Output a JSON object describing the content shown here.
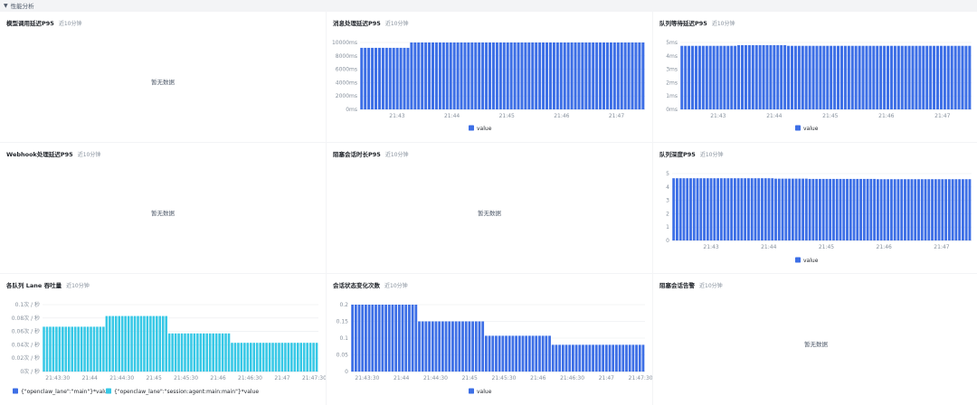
{
  "section": {
    "title": "性能分析"
  },
  "colors": {
    "blue": "#3d6fe6",
    "cyan": "#37c8e6",
    "grid": "#e8eaed",
    "axis": "#86909c"
  },
  "panels": [
    {
      "id": "model-call-latency",
      "title": "模型调用延迟P95",
      "subtitle": "近10分钟",
      "empty": "暂无数据"
    },
    {
      "id": "msg-latency",
      "title": "消息处理延迟P95",
      "subtitle": "近10分钟",
      "legend": [
        "value"
      ]
    },
    {
      "id": "queue-wait",
      "title": "队列等待延迟P95",
      "subtitle": "近10分钟",
      "legend": [
        "value"
      ]
    },
    {
      "id": "webhook-latency",
      "title": "Webhook处理延迟P95",
      "subtitle": "近10分钟",
      "empty": "暂无数据"
    },
    {
      "id": "blocked-session",
      "title": "阻塞会话时长P95",
      "subtitle": "近10分钟",
      "empty": "暂无数据"
    },
    {
      "id": "queue-depth",
      "title": "队列深度P95",
      "subtitle": "近10分钟",
      "legend": [
        "value"
      ]
    },
    {
      "id": "lane-throughput",
      "title": "各队列 Lane 吞吐量",
      "subtitle": "近10分钟",
      "legend": [
        "{\"openclaw_lane\":\"main\"}*value",
        "{\"openclaw_lane\":\"session:agent:main:main\"}*value"
      ]
    },
    {
      "id": "session-state",
      "title": "会话状态变化次数",
      "subtitle": "近10分钟",
      "legend": [
        "value"
      ]
    },
    {
      "id": "blocked-alert",
      "title": "阻塞会话告警",
      "subtitle": "近10分钟",
      "empty": "暂无数据"
    }
  ],
  "chart_data": [
    {
      "type": "bar",
      "panel": "msg-latency",
      "y_ticks": [
        "0ms",
        "2000ms",
        "4000ms",
        "6000ms",
        "8000ms",
        "10000ms"
      ],
      "x_ticks": [
        "21:43",
        "21:44",
        "21:45",
        "21:46",
        "21:47"
      ],
      "ylim": [
        0,
        10000
      ],
      "series": [
        {
          "name": "value",
          "values": [
            9200,
            9200,
            9200,
            9200,
            9200,
            9200,
            9200,
            9200,
            9200,
            9200,
            9200,
            9200,
            9200,
            9200,
            10000,
            10000,
            10000,
            10000,
            10000,
            10000,
            10000,
            10000,
            10000,
            10000,
            10000,
            10000,
            10000,
            10000,
            10000,
            10000,
            10000,
            10000,
            10000,
            10000,
            10000,
            10000,
            10000,
            10000,
            10000,
            10000,
            10000,
            10000,
            10000,
            10000,
            10000,
            10000,
            10000,
            10000,
            10000,
            10000,
            10000,
            10000,
            10000,
            10000,
            10000,
            10000,
            10000,
            10000,
            10000,
            10000,
            10000,
            10000,
            10000,
            10000,
            10000,
            10000,
            10000,
            10000,
            10000,
            10000,
            10000,
            10000,
            10000,
            10000,
            10000,
            10000,
            10000,
            10000,
            10000,
            10000
          ]
        }
      ]
    },
    {
      "type": "bar",
      "panel": "queue-wait",
      "y_ticks": [
        "0ms",
        "1ms",
        "2ms",
        "3ms",
        "4ms",
        "5ms"
      ],
      "x_ticks": [
        "21:43",
        "21:44",
        "21:45",
        "21:46",
        "21:47"
      ],
      "ylim": [
        0,
        5
      ],
      "series": [
        {
          "name": "value",
          "values": [
            4.75,
            4.75,
            4.75,
            4.75,
            4.75,
            4.75,
            4.75,
            4.75,
            4.75,
            4.75,
            4.75,
            4.75,
            4.75,
            4.75,
            4.75,
            4.75,
            4.8,
            4.8,
            4.8,
            4.8,
            4.8,
            4.8,
            4.8,
            4.8,
            4.8,
            4.8,
            4.8,
            4.8,
            4.8,
            4.8,
            4.75,
            4.75,
            4.75,
            4.75,
            4.75,
            4.75,
            4.75,
            4.75,
            4.75,
            4.75,
            4.75,
            4.75,
            4.75,
            4.75,
            4.75,
            4.75,
            4.75,
            4.75,
            4.75,
            4.75,
            4.75,
            4.75,
            4.75,
            4.75,
            4.75,
            4.75,
            4.75,
            4.75,
            4.75,
            4.75,
            4.75,
            4.75,
            4.75,
            4.75,
            4.75,
            4.75,
            4.75,
            4.75,
            4.75,
            4.75,
            4.75,
            4.75,
            4.75,
            4.75,
            4.75,
            4.75,
            4.75,
            4.75,
            4.75,
            4.75,
            4.75,
            4.75
          ]
        }
      ]
    },
    {
      "type": "bar",
      "panel": "queue-depth",
      "y_ticks": [
        "0",
        "1",
        "2",
        "3",
        "4",
        "5"
      ],
      "x_ticks": [
        "21:43",
        "21:44",
        "21:45",
        "21:46",
        "21:47"
      ],
      "ylim": [
        0,
        5
      ],
      "series": [
        {
          "name": "value",
          "values": [
            4.65,
            4.65,
            4.65,
            4.65,
            4.65,
            4.65,
            4.65,
            4.65,
            4.65,
            4.65,
            4.65,
            4.65,
            4.65,
            4.65,
            4.65,
            4.65,
            4.65,
            4.65,
            4.65,
            4.65,
            4.65,
            4.65,
            4.65,
            4.65,
            4.65,
            4.65,
            4.65,
            4.65,
            4.65,
            4.65,
            4.62,
            4.62,
            4.62,
            4.62,
            4.62,
            4.62,
            4.62,
            4.62,
            4.62,
            4.62,
            4.6,
            4.6,
            4.6,
            4.6,
            4.6,
            4.6,
            4.6,
            4.6,
            4.6,
            4.6,
            4.6,
            4.6,
            4.6,
            4.6,
            4.6,
            4.6,
            4.6,
            4.6,
            4.6,
            4.6,
            4.58,
            4.58,
            4.58,
            4.58,
            4.58,
            4.58,
            4.58,
            4.58,
            4.58,
            4.58,
            4.58,
            4.58,
            4.58,
            4.58,
            4.58,
            4.58,
            4.58,
            4.58,
            4.58,
            4.58,
            4.58,
            4.58,
            4.58,
            4.58,
            4.58,
            4.58,
            4.58,
            4.58
          ]
        }
      ]
    },
    {
      "type": "bar",
      "panel": "lane-throughput",
      "y_ticks": [
        "0次 / 秒",
        "0.02次 / 秒",
        "0.04次 / 秒",
        "0.06次 / 秒",
        "0.08次 / 秒",
        "0.1次 / 秒"
      ],
      "x_ticks": [
        "21:43:30",
        "21:44",
        "21:44:30",
        "21:45",
        "21:45:30",
        "21:46",
        "21:46:30",
        "21:47",
        "21:47:30"
      ],
      "ylim": [
        0,
        0.1
      ],
      "series": [
        {
          "name": "{\"openclaw_lane\":\"main\"}*value",
          "values": []
        },
        {
          "name": "{\"openclaw_lane\":\"session:agent:main:main\"}*value",
          "values": [
            0.067,
            0.067,
            0.067,
            0.067,
            0.067,
            0.067,
            0.067,
            0.067,
            0.067,
            0.067,
            0.067,
            0.067,
            0.067,
            0.067,
            0.067,
            0.067,
            0.067,
            0.067,
            0.067,
            0.067,
            0.083,
            0.083,
            0.083,
            0.083,
            0.083,
            0.083,
            0.083,
            0.083,
            0.083,
            0.083,
            0.083,
            0.083,
            0.083,
            0.083,
            0.083,
            0.083,
            0.083,
            0.083,
            0.083,
            0.083,
            0.057,
            0.057,
            0.057,
            0.057,
            0.057,
            0.057,
            0.057,
            0.057,
            0.057,
            0.057,
            0.057,
            0.057,
            0.057,
            0.057,
            0.057,
            0.057,
            0.057,
            0.057,
            0.057,
            0.057,
            0.043,
            0.043,
            0.043,
            0.043,
            0.043,
            0.043,
            0.043,
            0.043,
            0.043,
            0.043,
            0.043,
            0.043,
            0.043,
            0.043,
            0.043,
            0.043,
            0.043,
            0.043,
            0.043,
            0.043,
            0.043,
            0.043,
            0.043,
            0.043,
            0.043,
            0.043,
            0.043,
            0.043
          ]
        }
      ]
    },
    {
      "type": "bar",
      "panel": "session-state",
      "y_ticks": [
        "0",
        "0.05",
        "0.1",
        "0.15",
        "0.2"
      ],
      "x_ticks": [
        "21:43:30",
        "21:44",
        "21:44:30",
        "21:45",
        "21:45:30",
        "21:46",
        "21:46:30",
        "21:47",
        "21:47:30"
      ],
      "ylim": [
        0,
        0.2
      ],
      "series": [
        {
          "name": "value",
          "values": [
            0.2,
            0.2,
            0.2,
            0.2,
            0.2,
            0.2,
            0.2,
            0.2,
            0.2,
            0.2,
            0.2,
            0.2,
            0.2,
            0.2,
            0.2,
            0.2,
            0.2,
            0.2,
            0.2,
            0.2,
            0.15,
            0.15,
            0.15,
            0.15,
            0.15,
            0.15,
            0.15,
            0.15,
            0.15,
            0.15,
            0.15,
            0.15,
            0.15,
            0.15,
            0.15,
            0.15,
            0.15,
            0.15,
            0.15,
            0.15,
            0.107,
            0.107,
            0.107,
            0.107,
            0.107,
            0.107,
            0.107,
            0.107,
            0.107,
            0.107,
            0.107,
            0.107,
            0.107,
            0.107,
            0.107,
            0.107,
            0.107,
            0.107,
            0.107,
            0.107,
            0.08,
            0.08,
            0.08,
            0.08,
            0.08,
            0.08,
            0.08,
            0.08,
            0.08,
            0.08,
            0.08,
            0.08,
            0.08,
            0.08,
            0.08,
            0.08,
            0.08,
            0.08,
            0.08,
            0.08,
            0.08,
            0.08,
            0.08,
            0.08,
            0.08,
            0.08,
            0.08,
            0.08
          ]
        }
      ]
    }
  ]
}
